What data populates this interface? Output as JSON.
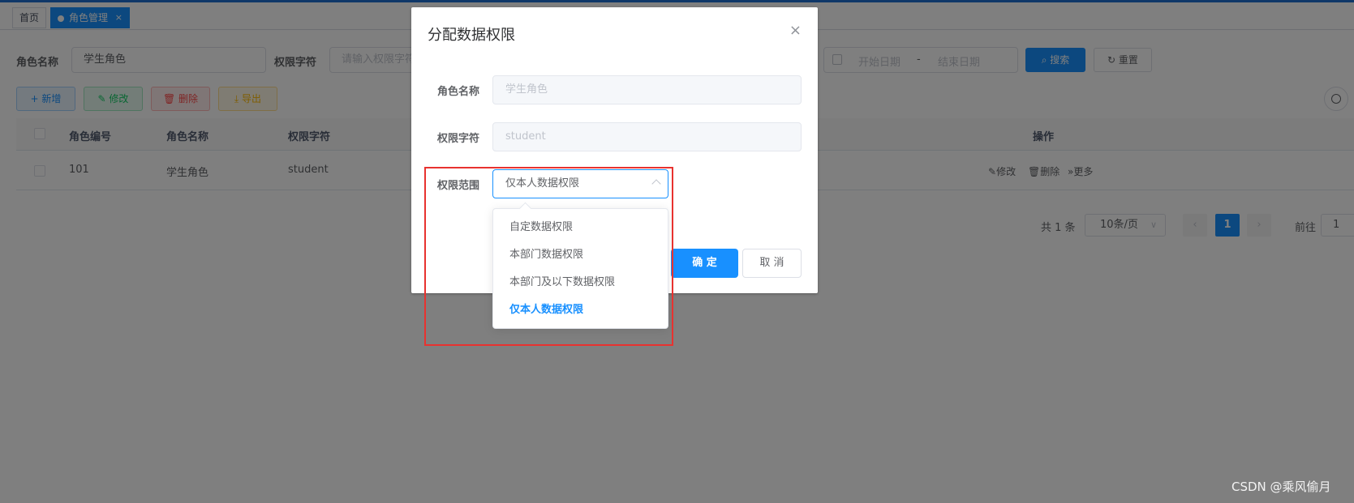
{
  "tags": {
    "home": "首页",
    "active": "角色管理",
    "close": "×"
  },
  "search": {
    "role_name_label": "角色名称",
    "role_name_value": "学生角色",
    "perm_label": "权限字符",
    "perm_placeholder": "请输入权限字符",
    "date_start": "开始日期",
    "date_sep": "-",
    "date_end": "结束日期",
    "search_button": "搜索",
    "reset_button": "重置"
  },
  "toolbar": {
    "add": "新增",
    "edit": "修改",
    "delete": "删除",
    "export": "导出"
  },
  "table": {
    "headers": [
      "角色编号",
      "角色名称",
      "权限字符",
      "操作"
    ],
    "rows": [
      {
        "id": "101",
        "name": "学生角色",
        "key": "student",
        "actions": [
          "修改",
          "删除",
          "更多"
        ]
      }
    ]
  },
  "pagination": {
    "total": "共 1 条",
    "page_size": "10条/页",
    "current": "1",
    "goto_label": "前往",
    "goto_value": "1"
  },
  "dialog": {
    "title": "分配数据权限",
    "role_name_label": "角色名称",
    "role_name_value": "学生角色",
    "perm_label": "权限字符",
    "perm_value": "student",
    "scope_label": "权限范围",
    "scope_value": "仅本人数据权限",
    "ok": "确 定",
    "cancel": "取 消",
    "close": "×",
    "options": [
      "自定数据权限",
      "本部门数据权限",
      "本部门及以下数据权限",
      "仅本人数据权限"
    ],
    "selected_option": "仅本人数据权限"
  },
  "watermark": "CSDN @乘风偷月",
  "colors": {
    "primary": "#1890ff",
    "highlight_box": "#e8322f"
  }
}
